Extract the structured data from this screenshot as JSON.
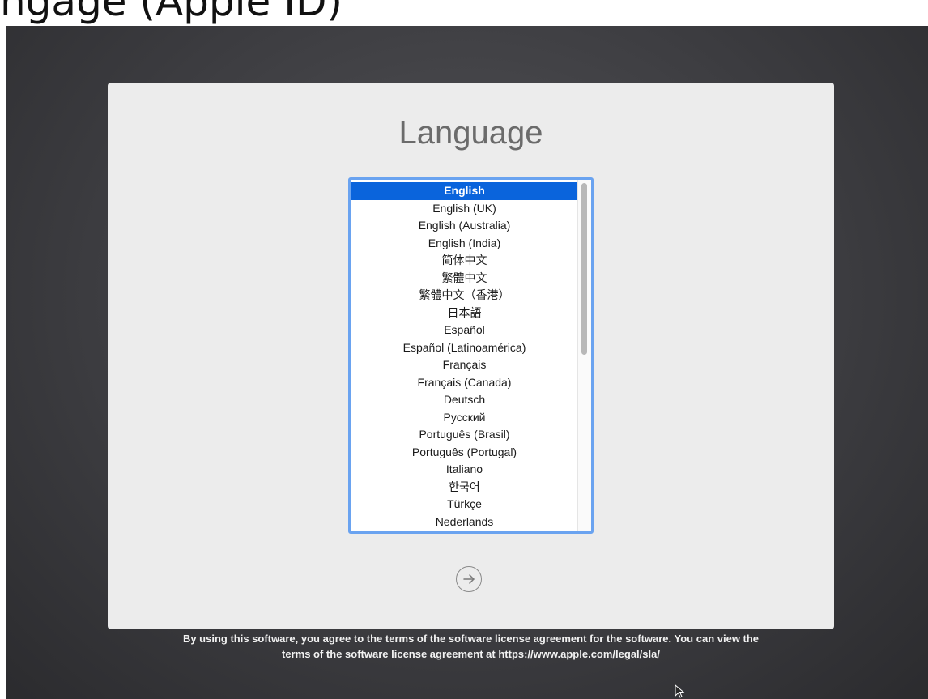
{
  "banner": {
    "text": "ngage (Apple ID)"
  },
  "panel": {
    "title": "Language"
  },
  "languages": {
    "selected_index": 0,
    "items": [
      "English",
      "English (UK)",
      "English (Australia)",
      "English (India)",
      "简体中文",
      "繁體中文",
      "繁體中文（香港）",
      "日本語",
      "Español",
      "Español (Latinoamérica)",
      "Français",
      "Français (Canada)",
      "Deutsch",
      "Русский",
      "Português (Brasil)",
      "Português (Portugal)",
      "Italiano",
      "한국어",
      "Türkçe",
      "Nederlands"
    ]
  },
  "next_button": {
    "icon": "arrow-right-circle-icon"
  },
  "footer": {
    "license_line1": "By using this software, you agree to the terms of the software license agreement for the software. You can view the",
    "license_line2": "terms of the software license agreement at https://www.apple.com/legal/sla/"
  },
  "colors": {
    "selection": "#0a64dc",
    "focus_ring": "#6aa3f0",
    "panel": "#ececec",
    "background": "#3d3d41"
  }
}
